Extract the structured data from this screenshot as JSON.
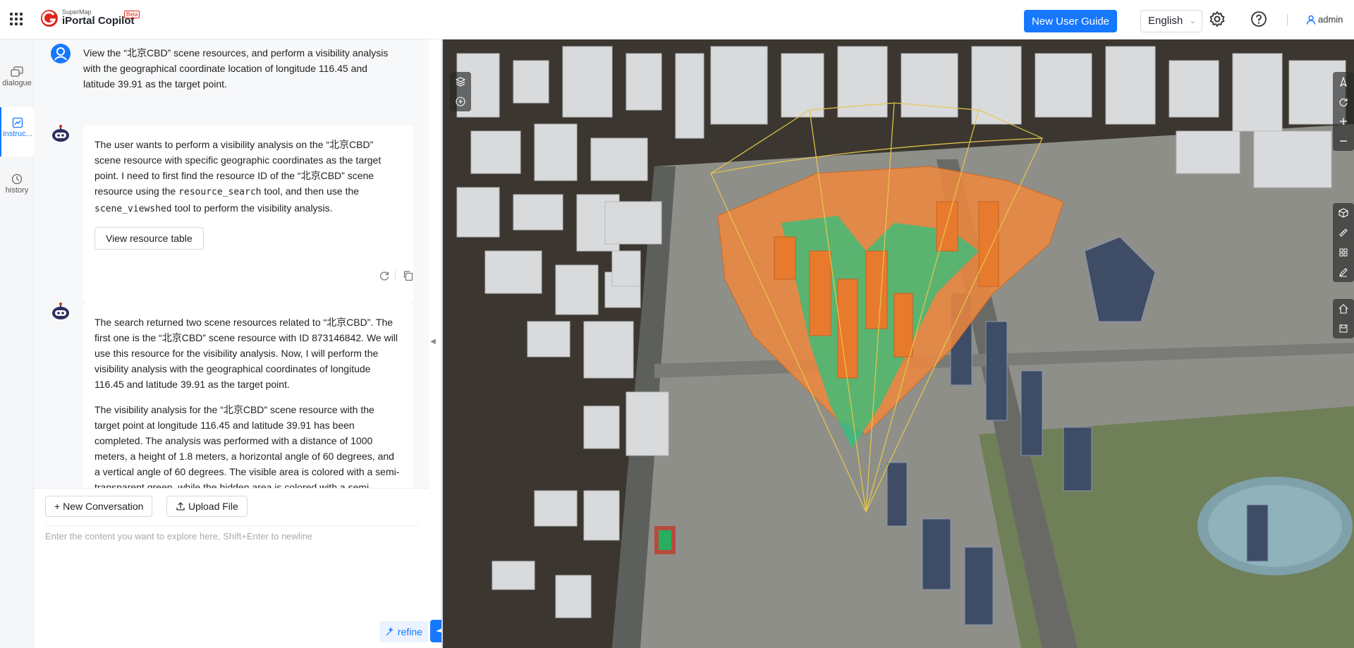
{
  "header": {
    "brand_sub": "SuperMap",
    "brand": "iPortal Copilot",
    "beta": "Beta",
    "new_user_guide": "New User Guide",
    "language": "English",
    "user": "admin"
  },
  "rail": {
    "items": [
      {
        "label": "dialogue",
        "icon": "dialogue-icon"
      },
      {
        "label": "instruc...",
        "icon": "instruction-icon"
      },
      {
        "label": "history",
        "icon": "history-icon"
      }
    ]
  },
  "chat": {
    "user_message": "View the “北京CBD” scene resources, and perform a visibility analysis with the geographical coordinate location of longitude 116.45 and latitude 39.91 as the target point.",
    "reply1": {
      "part1": "The user wants to perform a visibility analysis on the “北京CBD” scene resource with specific geographic coordinates as the target point. I need to first find the resource ID of the “北京CBD” scene resource using the ",
      "code1": "resource_search",
      "part2": " tool, and then use the ",
      "code2": "scene_viewshed",
      "part3": " tool to perform the visibility analysis.",
      "button": "View resource table"
    },
    "reply2": {
      "para1": "The search returned two scene resources related to “北京CBD”. The first one is the “北京CBD” scene resource with ID 873146842. We will use this resource for the visibility analysis. Now, I will perform the visibility analysis with the geographical coordinates of longitude 116.45 and latitude 39.91 as the target point.",
      "para2": "The visibility analysis for the “北京CBD” scene resource with the target point at longitude 116.45 and latitude 39.91 has been completed. The analysis was performed with a distance of 1000 meters, a height of 1.8 meters, a horizontal angle of 60 degrees, and a vertical angle of 60 degrees. The visible area is colored with a semi-transparent green, while the hidden area is colored with a semi-transparent orange."
    }
  },
  "composer": {
    "new_conversation": "New Conversation",
    "upload_file": "Upload File",
    "placeholder": "Enter the content you want to explore here, Shift+Enter to newline",
    "refine": "refine"
  },
  "colors": {
    "accent": "#1677ff",
    "visible_area": "#2ec27e",
    "hidden_area": "#f0883e"
  }
}
